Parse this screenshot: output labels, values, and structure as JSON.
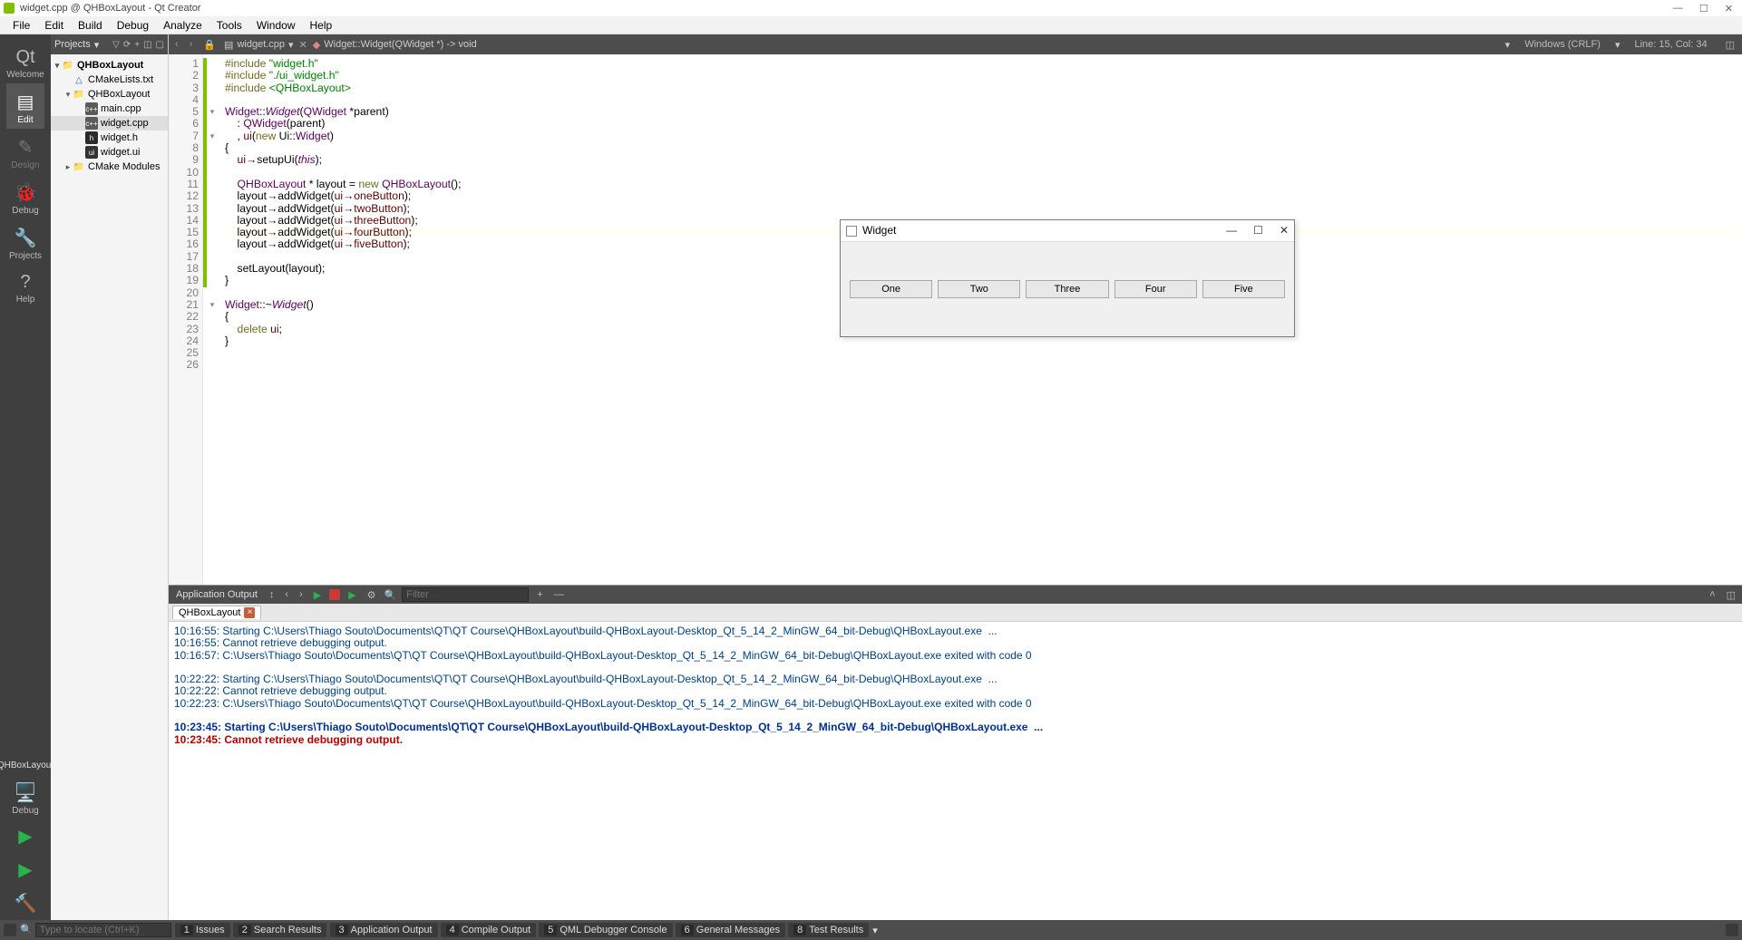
{
  "window": {
    "title": "widget.cpp @ QHBoxLayout - Qt Creator"
  },
  "menubar": [
    "File",
    "Edit",
    "Build",
    "Debug",
    "Analyze",
    "Tools",
    "Window",
    "Help"
  ],
  "modes": [
    {
      "label": "Welcome",
      "active": false
    },
    {
      "label": "Edit",
      "active": true
    },
    {
      "label": "Design",
      "active": false,
      "dim": true
    },
    {
      "label": "Debug",
      "active": false
    },
    {
      "label": "Projects",
      "active": false
    },
    {
      "label": "Help",
      "active": false
    }
  ],
  "kit": "QHBoxLayout",
  "kitMode": "Debug",
  "projpanel": {
    "header": "Projects",
    "tree": [
      {
        "lv": 1,
        "tw": "▾",
        "bold": true,
        "icon": "folder",
        "label": "QHBoxLayout"
      },
      {
        "lv": 2,
        "tw": "",
        "icon": "cmake",
        "label": "CMakeLists.txt"
      },
      {
        "lv": 2,
        "tw": "▾",
        "icon": "folder",
        "label": "QHBoxLayout"
      },
      {
        "lv": 3,
        "tw": "",
        "icon": "cpp",
        "label": "main.cpp"
      },
      {
        "lv": 3,
        "tw": "",
        "icon": "cpp",
        "label": "widget.cpp",
        "sel": true
      },
      {
        "lv": 3,
        "tw": "",
        "icon": "h",
        "label": "widget.h"
      },
      {
        "lv": 3,
        "tw": "",
        "icon": "ui",
        "label": "widget.ui"
      },
      {
        "lv": 2,
        "tw": "▸",
        "icon": "folder",
        "label": "CMake Modules"
      }
    ]
  },
  "editor": {
    "tabfile": "widget.cpp",
    "breadcrumb": "Widget::Widget(QWidget *) -> void",
    "encoding": "Windows (CRLF)",
    "position": "Line: 15, Col: 34",
    "lines": [
      {
        "n": 1,
        "c": "g",
        "html": "<span class='kw'>#include</span> <span class='str'>\"widget.h\"</span>"
      },
      {
        "n": 2,
        "c": "g",
        "html": "<span class='kw'>#include</span> <span class='str'>\"./ui_widget.h\"</span>"
      },
      {
        "n": 3,
        "c": "g",
        "html": "<span class='kw'>#include</span> <span class='inc'>&lt;QHBoxLayout&gt;</span>"
      },
      {
        "n": 4,
        "c": "g",
        "html": ""
      },
      {
        "n": 5,
        "c": "g",
        "fold": "▾",
        "html": "<span class='type'>Widget</span>::<span class='type ital'>Widget</span>(<span class='type'>QWidget</span> *parent)"
      },
      {
        "n": 6,
        "c": "g",
        "html": "    : <span class='type'>QWidget</span>(parent)"
      },
      {
        "n": 7,
        "c": "g",
        "fold": "▾",
        "html": "    , <span class='mem'>ui</span>(<span class='kw'>new</span> Ui::<span class='type'>Widget</span>)"
      },
      {
        "n": 8,
        "c": "g",
        "html": "{"
      },
      {
        "n": 9,
        "c": "g",
        "html": "    <span class='mem'>ui</span>→<span class='func'>setupUi</span>(<span class='pself'>this</span>);"
      },
      {
        "n": 10,
        "c": "g",
        "html": ""
      },
      {
        "n": 11,
        "c": "g",
        "html": "    <span class='type'>QHBoxLayout</span> * layout = <span class='kw'>new</span> <span class='type'>QHBoxLayout</span>();"
      },
      {
        "n": 12,
        "c": "g",
        "html": "    layout→<span class='func'>addWidget</span>(<span class='mem'>ui</span>→<span class='mem'>oneButton</span>);"
      },
      {
        "n": 13,
        "c": "g",
        "html": "    layout→<span class='func'>addWidget</span>(<span class='mem'>ui</span>→<span class='mem'>twoButton</span>);"
      },
      {
        "n": 14,
        "c": "g",
        "html": "    layout→<span class='func'>addWidget</span>(<span class='mem'>ui</span>→<span class='mem'>threeButton</span>);"
      },
      {
        "n": 15,
        "c": "g",
        "cls": "cursorline",
        "html": "    layout→<span class='func'>addWidget</span>(<span class='mem'>ui</span>→<span class='mem'>fourButton</span>);"
      },
      {
        "n": 16,
        "c": "g",
        "html": "    layout→<span class='func'>addWidget</span>(<span class='mem'>ui</span>→<span class='mem'>fiveButton</span>);"
      },
      {
        "n": 17,
        "c": "g",
        "html": ""
      },
      {
        "n": 18,
        "c": "g",
        "html": "    <span class='func'>setLayout</span>(layout);"
      },
      {
        "n": 19,
        "c": "g",
        "html": "}"
      },
      {
        "n": 20,
        "c": "",
        "html": ""
      },
      {
        "n": 21,
        "c": "",
        "fold": "▾",
        "html": "<span class='type'>Widget</span>::~<span class='type ital'>Widget</span>()"
      },
      {
        "n": 22,
        "c": "",
        "html": "{"
      },
      {
        "n": 23,
        "c": "",
        "html": "    <span class='kw'>delete</span> <span class='mem'>ui</span>;"
      },
      {
        "n": 24,
        "c": "",
        "html": "}"
      },
      {
        "n": 25,
        "c": "",
        "html": ""
      },
      {
        "n": 26,
        "c": "",
        "html": ""
      }
    ]
  },
  "widgetwin": {
    "title": "Widget",
    "buttons": [
      "One",
      "Two",
      "Three",
      "Four",
      "Five"
    ]
  },
  "output": {
    "panelTitle": "Application Output",
    "filterPlaceholder": "Filter",
    "tab": "QHBoxLayout",
    "lines": [
      {
        "cls": "dim",
        "text": "10:16:55: Starting C:\\Users\\Thiago Souto\\Documents\\QT\\QT Course\\QHBoxLayout\\build-QHBoxLayout-Desktop_Qt_5_14_2_MinGW_64_bit-Debug\\QHBoxLayout.exe  ..."
      },
      {
        "cls": "dim",
        "text": "10:16:55: Cannot retrieve debugging output."
      },
      {
        "cls": "dim",
        "text": "10:16:57: C:\\Users\\Thiago Souto\\Documents\\QT\\QT Course\\QHBoxLayout\\build-QHBoxLayout-Desktop_Qt_5_14_2_MinGW_64_bit-Debug\\QHBoxLayout.exe exited with code 0"
      },
      {
        "cls": "",
        "text": ""
      },
      {
        "cls": "dim",
        "text": "10:22:22: Starting C:\\Users\\Thiago Souto\\Documents\\QT\\QT Course\\QHBoxLayout\\build-QHBoxLayout-Desktop_Qt_5_14_2_MinGW_64_bit-Debug\\QHBoxLayout.exe  ..."
      },
      {
        "cls": "dim",
        "text": "10:22:22: Cannot retrieve debugging output."
      },
      {
        "cls": "dim",
        "text": "10:22:23: C:\\Users\\Thiago Souto\\Documents\\QT\\QT Course\\QHBoxLayout\\build-QHBoxLayout-Desktop_Qt_5_14_2_MinGW_64_bit-Debug\\QHBoxLayout.exe exited with code 0"
      },
      {
        "cls": "",
        "text": ""
      },
      {
        "cls": "bluebold",
        "text": "10:23:45: Starting C:\\Users\\Thiago Souto\\Documents\\QT\\QT Course\\QHBoxLayout\\build-QHBoxLayout-Desktop_Qt_5_14_2_MinGW_64_bit-Debug\\QHBoxLayout.exe  ..."
      },
      {
        "cls": "red bold",
        "text": "10:23:45: Cannot retrieve debugging output."
      }
    ]
  },
  "statusbar": {
    "locatorPlaceholder": "Type to locate (Ctrl+K)",
    "tabs": [
      {
        "n": "1",
        "label": "Issues"
      },
      {
        "n": "2",
        "label": "Search Results"
      },
      {
        "n": "3",
        "label": "Application Output"
      },
      {
        "n": "4",
        "label": "Compile Output"
      },
      {
        "n": "5",
        "label": "QML Debugger Console"
      },
      {
        "n": "6",
        "label": "General Messages"
      },
      {
        "n": "8",
        "label": "Test Results"
      }
    ]
  }
}
